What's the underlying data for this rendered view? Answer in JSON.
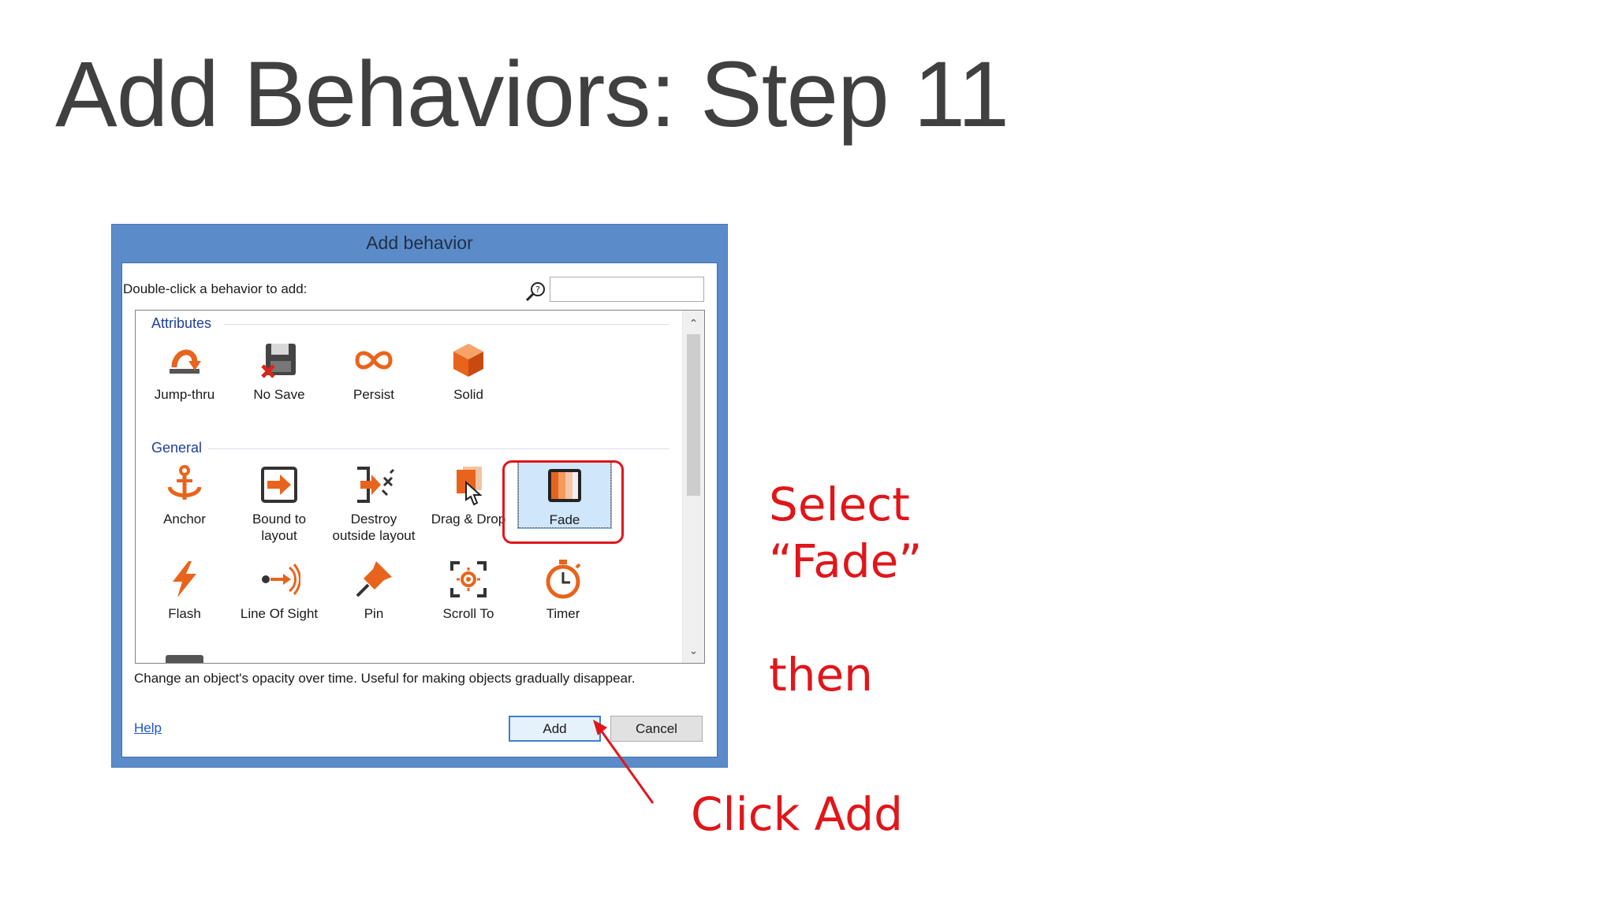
{
  "slide": {
    "title": "Add Behaviors: Step 11"
  },
  "dialog": {
    "title": "Add behavior",
    "hint": "Double-click a behavior to add:",
    "search": {
      "value": "",
      "placeholder": ""
    },
    "groups": [
      {
        "name": "Attributes",
        "items": [
          "Jump-thru",
          "No Save",
          "Persist",
          "Solid"
        ]
      },
      {
        "name": "General",
        "items": [
          "Anchor",
          "Bound to layout",
          "Destroy outside layout",
          "Drag & Drop",
          "Fade",
          "Flash",
          "Line Of Sight",
          "Pin",
          "Scroll To",
          "Timer"
        ]
      }
    ],
    "labels": {
      "jump_thru": "Jump-thru",
      "no_save": "No Save",
      "persist": "Persist",
      "solid": "Solid",
      "anchor": "Anchor",
      "bound_line1": "Bound to",
      "bound_line2": "layout",
      "destroy_line1": "Destroy",
      "destroy_line2": "outside layout",
      "drag_drop": "Drag & Drop",
      "fade": "Fade",
      "flash": "Flash",
      "line_of_sight": "Line Of Sight",
      "pin": "Pin",
      "scroll_to": "Scroll To",
      "timer": "Timer"
    },
    "selected_item": "Fade",
    "description": "Change an object's opacity over time.  Useful for making objects gradually disappear.",
    "help_label": "Help",
    "add_label": "Add",
    "cancel_label": "Cancel"
  },
  "annotations": {
    "select_line1": "Select",
    "select_line2": "“Fade”",
    "then": "then",
    "click_add": "Click Add"
  },
  "colors": {
    "accent_red": "#e0161a",
    "dialog_frame": "#5b8cc9",
    "group_header": "#1f3f9c",
    "icon_orange": "#e8641c"
  }
}
